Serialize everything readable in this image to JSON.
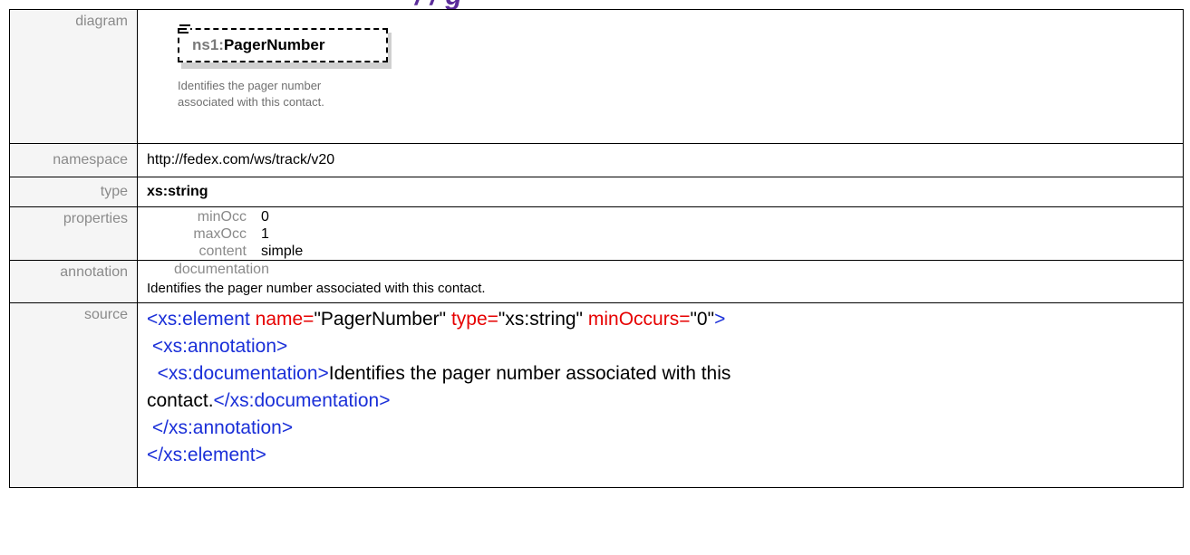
{
  "page": {
    "title_fragment": "/ / g"
  },
  "rows": {
    "diagram": {
      "label": "diagram",
      "prefix": "ns1:",
      "element_name": "PagerNumber",
      "doc": "Identifies the pager number associated with this contact."
    },
    "namespace": {
      "label": "namespace",
      "value": "http://fedex.com/ws/track/v20"
    },
    "type": {
      "label": "type",
      "value": "xs:string"
    },
    "properties": {
      "label": "properties",
      "items": [
        {
          "key": "minOcc",
          "value": "0"
        },
        {
          "key": "maxOcc",
          "value": "1"
        },
        {
          "key": "content",
          "value": "simple"
        }
      ]
    },
    "annotation": {
      "label": "annotation",
      "key": "documentation",
      "text": "Identifies the pager number associated with this contact."
    },
    "source": {
      "label": "source",
      "l1_open": "<xs:element",
      "l1_name_attr": "name=",
      "l1_name_val": "\"PagerNumber\"",
      "l1_type_attr": "type=",
      "l1_type_val": "\"xs:string\"",
      "l1_min_attr": "minOccurs=",
      "l1_min_val": "\"0\"",
      "l1_close": ">",
      "l2": "<xs:annotation>",
      "l3_open": "<xs:documentation>",
      "l3_text": "Identifies the pager number associated with this",
      "l4_text": "contact.",
      "l4_close": "</xs:documentation>",
      "l5": "</xs:annotation>",
      "l6": "</xs:element>"
    }
  }
}
